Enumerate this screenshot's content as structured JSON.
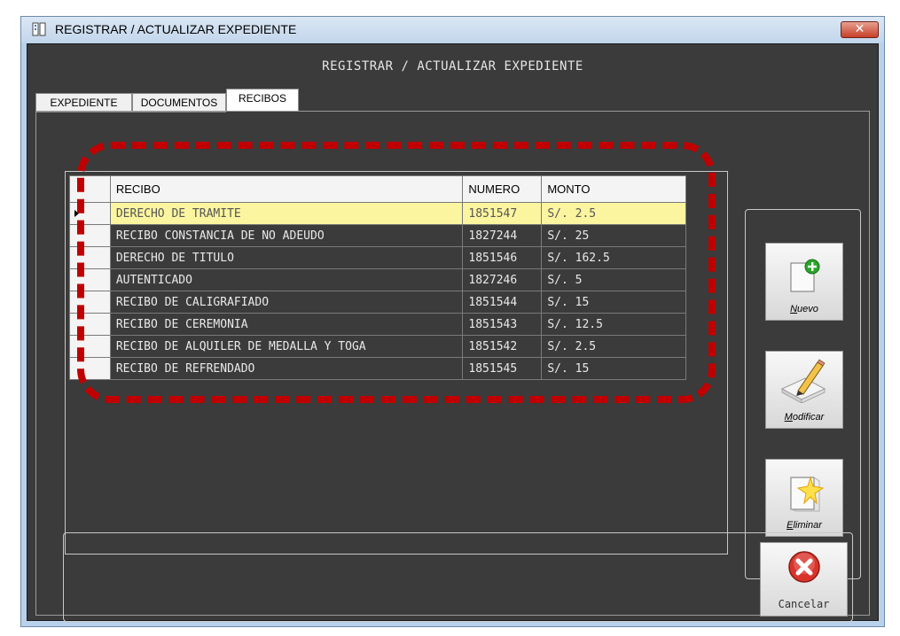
{
  "window": {
    "title": "REGISTRAR / ACTUALIZAR EXPEDIENTE",
    "close_glyph": "✕"
  },
  "header": {
    "title": "REGISTRAR / ACTUALIZAR EXPEDIENTE"
  },
  "tabs": [
    {
      "label": "EXPEDIENTE",
      "active": false
    },
    {
      "label": "DOCUMENTOS",
      "active": false
    },
    {
      "label": "RECIBOS",
      "active": true
    }
  ],
  "grid": {
    "columns": [
      "RECIBO",
      "NUMERO",
      "MONTO"
    ],
    "selected_row": 0,
    "rows": [
      {
        "recibo": "DERECHO DE TRAMITE",
        "numero": "1851547",
        "monto": "S/. 2.5"
      },
      {
        "recibo": "RECIBO CONSTANCIA DE NO ADEUDO",
        "numero": "1827244",
        "monto": "S/. 25"
      },
      {
        "recibo": "DERECHO DE TITULO",
        "numero": "1851546",
        "monto": "S/. 162.5"
      },
      {
        "recibo": "AUTENTICADO",
        "numero": "1827246",
        "monto": "S/. 5"
      },
      {
        "recibo": "RECIBO DE CALIGRAFIADO",
        "numero": "1851544",
        "monto": "S/. 15"
      },
      {
        "recibo": "RECIBO DE CEREMONIA",
        "numero": "1851543",
        "monto": "S/. 12.5"
      },
      {
        "recibo": "RECIBO DE ALQUILER DE MEDALLA Y TOGA",
        "numero": "1851542",
        "monto": "S/. 2.5"
      },
      {
        "recibo": "RECIBO DE REFRENDADO",
        "numero": "1851545",
        "monto": "S/. 15"
      }
    ]
  },
  "actions": {
    "nuevo": {
      "label": "Nuevo",
      "icon": "new-document-icon"
    },
    "modificar": {
      "label": "Modificar",
      "icon": "edit-pencil-icon"
    },
    "eliminar": {
      "label": "Eliminar",
      "icon": "delete-star-icon"
    },
    "cancelar": {
      "label": "Cancelar",
      "icon": "cancel-x-icon"
    }
  },
  "colors": {
    "background": "#3b3b3b",
    "selected_row": "#fbf5a0",
    "annotation": "#c00000",
    "add_green": "#2aa52a",
    "cancel_red": "#d9342b"
  }
}
